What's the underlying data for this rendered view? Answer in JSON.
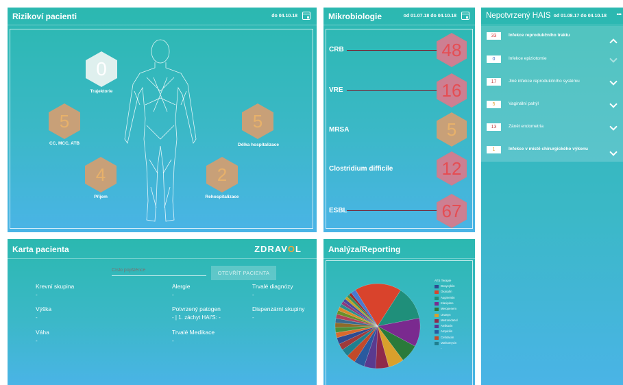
{
  "rizikovi": {
    "title": "Rizikoví pacienti",
    "date": "do 04.10.18",
    "hexes": [
      {
        "value": "0",
        "label": "Trajektorie"
      },
      {
        "value": "5",
        "label": "CC, MCC, ATB"
      },
      {
        "value": "5",
        "label": "Délka hospitalizace"
      },
      {
        "value": "4",
        "label": "Příjem"
      },
      {
        "value": "2",
        "label": "Rehospitalizace"
      }
    ]
  },
  "mikrobiologie": {
    "title": "Mikrobiologie",
    "date": "od 01.07.18 do 04.10.18",
    "items": [
      {
        "label": "CRB",
        "value": "48",
        "color": "pink"
      },
      {
        "label": "VRE",
        "value": "16",
        "color": "pink"
      },
      {
        "label": "MRSA",
        "value": "5",
        "color": "orange"
      },
      {
        "label": "Clostridium difficile",
        "value": "12",
        "color": "pink"
      },
      {
        "label": "ESBL",
        "value": "67",
        "color": "pink"
      }
    ]
  },
  "hais": {
    "title": "Nepotvrzený HAIS",
    "date": "od 01.08.17 do 04.10.18",
    "more": "•••",
    "rows": [
      {
        "count": "33",
        "label": "Infekce reprodukčního traktu",
        "count_color": "#d93c3c"
      },
      {
        "count": "0",
        "label": "Infekce epiziotomie",
        "count_color": "#3a6cc7"
      },
      {
        "count": "17",
        "label": "Jiné infekce reprodukčního systému",
        "count_color": "#c24a4a"
      },
      {
        "count": "5",
        "label": "Vaginální pahýl",
        "count_color": "#e0a030"
      },
      {
        "count": "13",
        "label": "Zánět endometria",
        "count_color": "#c24a4a"
      },
      {
        "count": "1",
        "label": "Infekce v místě chirurgického výkonu",
        "count_color": "#e0a030"
      }
    ]
  },
  "karta": {
    "title": "Karta pacienta",
    "brand": "ZDRAV",
    "brand_mid": "O",
    "brand_end": "L",
    "input_placeholder": "Číslo pojištěnce",
    "button": "OTEVŘÍT PACIENTA",
    "fields": [
      {
        "label": "Krevní skupina",
        "value": "-"
      },
      {
        "label": "Alergie",
        "value": "-"
      },
      {
        "label": "Trvalé diagnózy",
        "value": "-"
      },
      {
        "label": "Výška",
        "value": "-"
      },
      {
        "label": "Potvrzený patogen",
        "value": "- | 1. záchyt HAI'S: -"
      },
      {
        "label": "Dispenzární skupiny",
        "value": "-"
      },
      {
        "label": "Váha",
        "value": "-"
      },
      {
        "label": "Trvalé Medikace",
        "value": "-"
      }
    ]
  },
  "analyza": {
    "title": "Analýza/Reporting",
    "legend_title": "ATS Terapie",
    "legend": [
      {
        "name": "Doxycyklin",
        "color": "#2f4a8f"
      },
      {
        "name": "Oxacylin",
        "color": "#d9432c"
      },
      {
        "name": "Augmentin",
        "color": "#1f8f7a"
      },
      {
        "name": "Klacipime",
        "color": "#7a2a8f"
      },
      {
        "name": "Meropenem",
        "color": "#2a7a3a"
      },
      {
        "name": "Unasyn",
        "color": "#d9a02c"
      },
      {
        "name": "Metronidazol",
        "color": "#8f2a4a"
      },
      {
        "name": "Amikacin",
        "color": "#5a3a8f"
      },
      {
        "name": "Ampicilin",
        "color": "#2a5a9f"
      },
      {
        "name": "Cefotaxim",
        "color": "#c24a2a"
      },
      {
        "name": "Vankomycin",
        "color": "#1f7f8f"
      },
      {
        "name": "-",
        "color": "none"
      }
    ]
  },
  "chart_data": {
    "type": "pie",
    "categories": [
      "s1",
      "s2",
      "s3",
      "s4",
      "s5",
      "s6",
      "s7",
      "s8",
      "s9",
      "s10",
      "s11",
      "s12",
      "s13",
      "s14",
      "s15",
      "s16",
      "s17",
      "s18",
      "s19",
      "s20",
      "s21",
      "s22",
      "s23",
      "s24",
      "s25",
      "s26"
    ],
    "values": [
      18,
      13,
      11,
      7,
      6,
      5,
      4.5,
      4,
      3.5,
      3,
      2.5,
      2.5,
      2,
      2,
      1.8,
      1.7,
      1.6,
      1.5,
      1.4,
      1.3,
      1.2,
      1.2,
      1.1,
      1.1,
      1,
      2
    ],
    "colors": [
      "#d9432c",
      "#1f8f7a",
      "#7a2a8f",
      "#2a7a3a",
      "#d9a02c",
      "#8f2a4a",
      "#5a3a8f",
      "#2a5a9f",
      "#c24a2a",
      "#1f7f8f",
      "#a03a3a",
      "#2f4a8f",
      "#d96a2c",
      "#4a8f3a",
      "#8f6a2a",
      "#3a6a8f",
      "#b0405a",
      "#6a8f2a",
      "#d98a2c",
      "#2a8f8f",
      "#8f3a7a",
      "#4a4a9f",
      "#c2a02a",
      "#3a8f5a",
      "#9f2a2a",
      "#4a7acf"
    ]
  }
}
